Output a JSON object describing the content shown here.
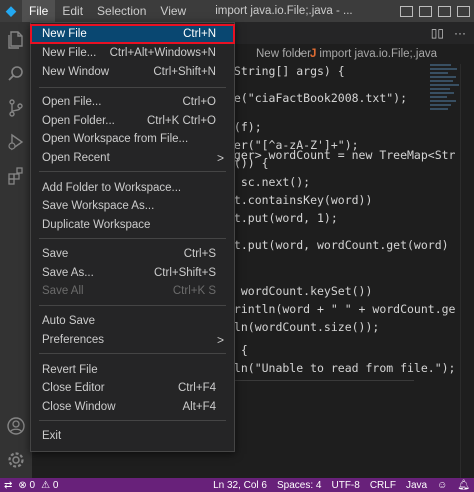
{
  "titlebar": {
    "menus": [
      "File",
      "Edit",
      "Selection",
      "View"
    ],
    "window_title": "import java.io.File;.java - ..."
  },
  "breadcrumb": {
    "folder": "New folder",
    "file_icon_text": "J",
    "file": "import java.io.File;.java"
  },
  "file_menu": {
    "items": [
      {
        "label": "New File",
        "shortcut": "Ctrl+N"
      },
      {
        "label": "New File...",
        "shortcut": "Ctrl+Alt+Windows+N"
      },
      {
        "label": "New Window",
        "shortcut": "Ctrl+Shift+N"
      },
      {
        "label": "Open File...",
        "shortcut": "Ctrl+O"
      },
      {
        "label": "Open Folder...",
        "shortcut": "Ctrl+K Ctrl+O"
      },
      {
        "label": "Open Workspace from File...",
        "shortcut": ""
      },
      {
        "label": "Open Recent",
        "shortcut": "",
        "submenu": ">"
      },
      {
        "label": "Add Folder to Workspace...",
        "shortcut": ""
      },
      {
        "label": "Save Workspace As...",
        "shortcut": ""
      },
      {
        "label": "Duplicate Workspace",
        "shortcut": ""
      },
      {
        "label": "Save",
        "shortcut": "Ctrl+S"
      },
      {
        "label": "Save As...",
        "shortcut": "Ctrl+Shift+S"
      },
      {
        "label": "Save All",
        "shortcut": "Ctrl+K S"
      },
      {
        "label": "Auto Save",
        "shortcut": ""
      },
      {
        "label": "Preferences",
        "shortcut": "",
        "submenu": ">"
      },
      {
        "label": "Revert File",
        "shortcut": ""
      },
      {
        "label": "Close Editor",
        "shortcut": "Ctrl+F4"
      },
      {
        "label": "Close Window",
        "shortcut": "Alt+F4"
      },
      {
        "label": "Exit",
        "shortcut": ""
      }
    ]
  },
  "code_lines": [
    {
      "t": "(String[] args) {"
    },
    {
      "t": "le(\"ciaFactBook2008.txt\");"
    },
    {
      "t": "r(f);"
    },
    {
      "t": "ter(\"[^a-zA-Z']+\");"
    },
    {
      "t": "t()) {"
    },
    {
      "t": "eger> wordCount = new TreeMap<Str"
    },
    {
      "t": "= sc.next();"
    },
    {
      "t": "nt.containsKey(word))"
    },
    {
      "t": "nt.put(word, 1);"
    },
    {
      "t": "nt.put(word, wordCount.get(word)"
    },
    {
      "t": ": wordCount.keySet())"
    },
    {
      "t": "println(word + \" \" + wordCount.ge"
    },
    {
      "t": "tln(wordCount.size());"
    },
    {
      "t": ") {"
    },
    {
      "t": "tln(\"Unable to read from file.\");"
    }
  ],
  "statusbar": {
    "errors": "⊗ 0",
    "warnings": "⚠ 0",
    "position": "Ln 32, Col 6",
    "spaces": "Spaces: 4",
    "encoding": "UTF-8",
    "eol": "CRLF",
    "language": "Java"
  },
  "colors": {
    "accent": "#094771",
    "highlight_border": "#e81123",
    "statusbar": "#68217a"
  }
}
